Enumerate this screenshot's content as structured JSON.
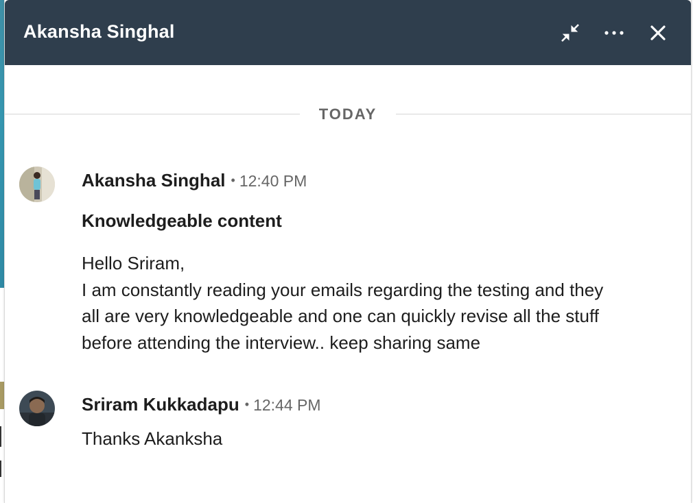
{
  "conversation": {
    "title": "Akansha Singhal",
    "date_divider": "TODAY",
    "messages": [
      {
        "sender": "Akansha Singhal",
        "time": "12:40 PM",
        "subject": "Knowledgeable content",
        "lines": [
          "Hello Sriram,",
          "I am constantly reading your emails regarding the testing and they",
          "all are very knowledgeable and one can quickly revise all the stuff",
          "before attending the interview.. keep sharing same"
        ]
      },
      {
        "sender": "Sriram Kukkadapu",
        "time": "12:44 PM",
        "lines": [
          "Thanks Akanksha"
        ]
      }
    ]
  },
  "icons": {
    "minimize": "minimize-arrows-icon",
    "more": "more-options-icon",
    "close": "close-icon"
  },
  "colors": {
    "header_bg": "#2f3e4d",
    "text_primary": "#1d1d1d",
    "text_secondary": "#666666"
  }
}
